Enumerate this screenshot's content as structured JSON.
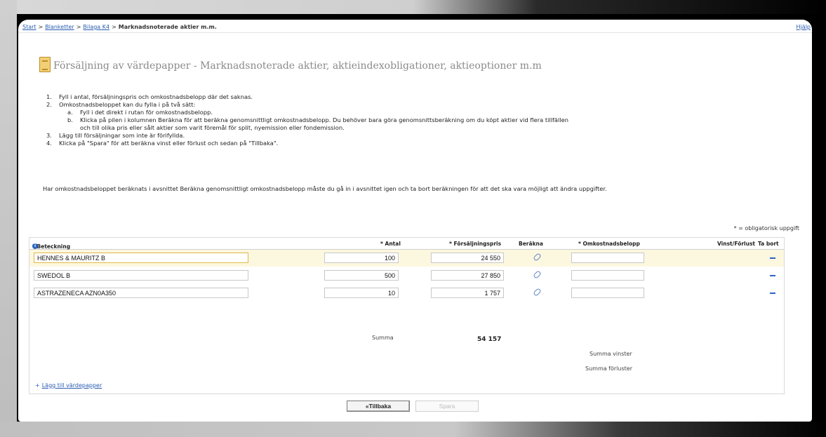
{
  "breadcrumb": {
    "items": [
      "Start",
      "Blanketter",
      "Bilaga K4"
    ],
    "current": "Marknadsnoterade aktier m.m."
  },
  "help_link": "Hjälp",
  "page_title": "Försäljning av värdepapper - Marknadsnoterade aktier, aktieindexobligationer, aktieoptioner m.m",
  "instructions": [
    {
      "num": "1.",
      "text": "Fyll i antal, försäljningspris och omkostnadsbelopp där det saknas."
    },
    {
      "num": "2.",
      "text": "Omkostnadsbeloppet kan du fylla i på två sätt:"
    },
    {
      "num": "a.",
      "text": "Fyll i det direkt i rutan för omkostnadsbelopp.",
      "sub": true
    },
    {
      "num": "b.",
      "text": "Klicka på pilen i kolumnen Beräkna för att beräkna genomsnittligt omkostnadsbelopp. Du behöver bara göra genomsnittsberäkning om du köpt aktier vid flera tillfällen",
      "sub": true
    },
    {
      "num": "",
      "text": "och till olika pris eller sålt aktier som varit föremål för split, nyemission eller fondemission.",
      "sub": true
    },
    {
      "num": "3.",
      "text": "Lägg till försäljningar som inte är förifyllda."
    },
    {
      "num": "4.",
      "text": "Klicka på \"Spara\" för att beräkna vinst eller förlust och sedan på \"Tillbaka\"."
    }
  ],
  "note": "Har omkostnadsbeloppet beräknats i avsnittet Beräkna genomsnittligt omkostnadsbelopp måste du gå in i avsnittet igen och ta bort beräkningen för att det ska vara möjligt att ändra uppgifter.",
  "mandatory_note": "* = obligatorisk uppgift",
  "columns": {
    "beteckning": "* Beteckning",
    "antal": "* Antal",
    "pris": "* Försäljningspris",
    "berakna": "Beräkna",
    "omkostnad": "* Omkostnadsbelopp",
    "vinst": "Vinst/Förlust",
    "tabort": "Ta bort"
  },
  "rows": [
    {
      "name": "HENNES & MAURITZ  B",
      "antal": "100",
      "pris": "24 550",
      "cost": ""
    },
    {
      "name": "SWEDOL  B",
      "antal": "500",
      "pris": "27 850",
      "cost": ""
    },
    {
      "name": "ASTRAZENECA AZN0A350",
      "antal": "10",
      "pris": "1 757",
      "cost": ""
    }
  ],
  "summa_label": "Summa",
  "summa_value": "54 157",
  "summa_vinster": "Summa vinster",
  "summa_forluster": "Summa förluster",
  "add_link": "Lägg till värdepapper",
  "buttons": {
    "back": "«Tillbaka",
    "save": "Spara"
  },
  "colors": {
    "highlight_row": "#fcf7df",
    "link": "#2a5db0"
  }
}
